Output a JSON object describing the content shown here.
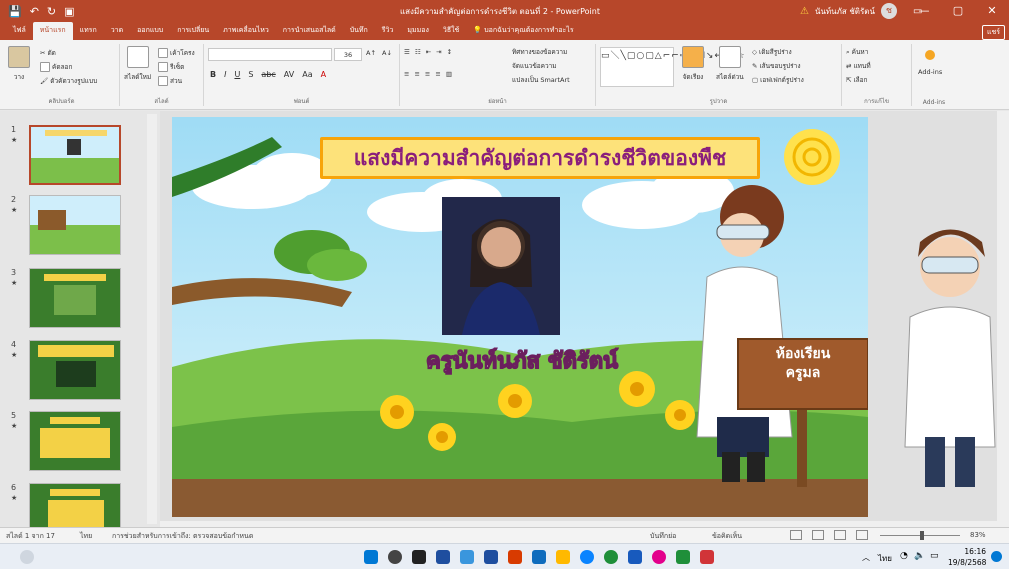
{
  "window": {
    "title": "แสงมีความสำคัญต่อการดำรงชีวิต ตอนที่ 2 - PowerPoint",
    "user_name": "นันท์นภัส ชัติรัตน์",
    "avatar_initial": "ช",
    "warning_icon": "warning-icon",
    "controls": [
      "—",
      "▢",
      "✕"
    ]
  },
  "qat": {
    "save": "💾",
    "undo": "↶",
    "redo": "↻",
    "present": "▣"
  },
  "tabs": [
    "ไฟล์",
    "หน้าแรก",
    "แทรก",
    "วาด",
    "ออกแบบ",
    "การเปลี่ยน",
    "ภาพเคลื่อนไหว",
    "การนำเสนอสไลด์",
    "บันทึก",
    "รีวิว",
    "มุมมอง",
    "วิธีใช้"
  ],
  "tell_me": "บอกฉันว่าคุณต้องการทำอะไร",
  "share": "แชร์",
  "ribbon": {
    "clipboard": {
      "paste": "วาง",
      "cut": "ตัด",
      "copy": "คัดลอก",
      "format_painter": "ตัวคัดวางรูปแบบ",
      "label": "คลิปบอร์ด"
    },
    "slides": {
      "new_slide": "สไลด์ใหม่",
      "layout": "เค้าโครง",
      "reset": "รีเซ็ต",
      "section": "ส่วน",
      "label": "สไลด์"
    },
    "font": {
      "label": "ฟอนต์",
      "size": "36",
      "buttons": [
        "B",
        "I",
        "U",
        "S",
        "abc",
        "AV",
        "Aa",
        "A"
      ]
    },
    "paragraph": {
      "label": "ย่อหน้า",
      "text_direction": "ทิศทางของข้อความ",
      "align_text": "จัดแนวข้อความ",
      "smartart": "แปลงเป็น SmartArt"
    },
    "drawing": {
      "label": "รูปวาด",
      "arrange": "จัดเรียง",
      "quick_styles": "สไตล์ด่วน",
      "shape_fill": "เติมสีรูปร่าง",
      "shape_outline": "เส้นขอบรูปร่าง",
      "shape_effects": "เอฟเฟกต์รูปร่าง"
    },
    "editing": {
      "label": "การแก้ไข",
      "find": "ค้นหา",
      "replace": "แทนที่",
      "select": "เลือก"
    },
    "addins": {
      "label": "Add-ins",
      "button": "Add-ins"
    }
  },
  "slide": {
    "title": "แสงมีความสำคัญต่อการดำรงชีวิตของพืช",
    "teacher_name": "ครูนันท์นภัส ชัติรัตน์",
    "sign_line1": "ห้องเรียน",
    "sign_line2": "ครูมล"
  },
  "thumbnails": [
    {
      "num": "1",
      "star": "★"
    },
    {
      "num": "2",
      "star": "★"
    },
    {
      "num": "3",
      "star": "★"
    },
    {
      "num": "4",
      "star": "★"
    },
    {
      "num": "5",
      "star": "★"
    },
    {
      "num": "6",
      "star": "★"
    }
  ],
  "status": {
    "slide_info": "สไลด์ 1 จาก 17",
    "language": "ไทย",
    "accessibility": "การช่วยสำหรับการเข้าถึง: ตรวจสอบข้อกำหนด",
    "notes": "บันทึกย่อ",
    "comments": "ข้อคิดเห็น",
    "zoom": "83%"
  },
  "taskbar": {
    "time": "16:16",
    "date": "19/8/2568",
    "lang": "ไทย",
    "colors": [
      "#0078d4",
      "#ffffff",
      "#444444",
      "#0f6cbd",
      "#1e4e9f",
      "#d83b01",
      "#c43e1c",
      "#0a84ff",
      "#ffb900",
      "#e81123",
      "#1f8f3a",
      "#185abd",
      "#e3008c",
      "#3a96dd",
      "#d13438"
    ]
  }
}
